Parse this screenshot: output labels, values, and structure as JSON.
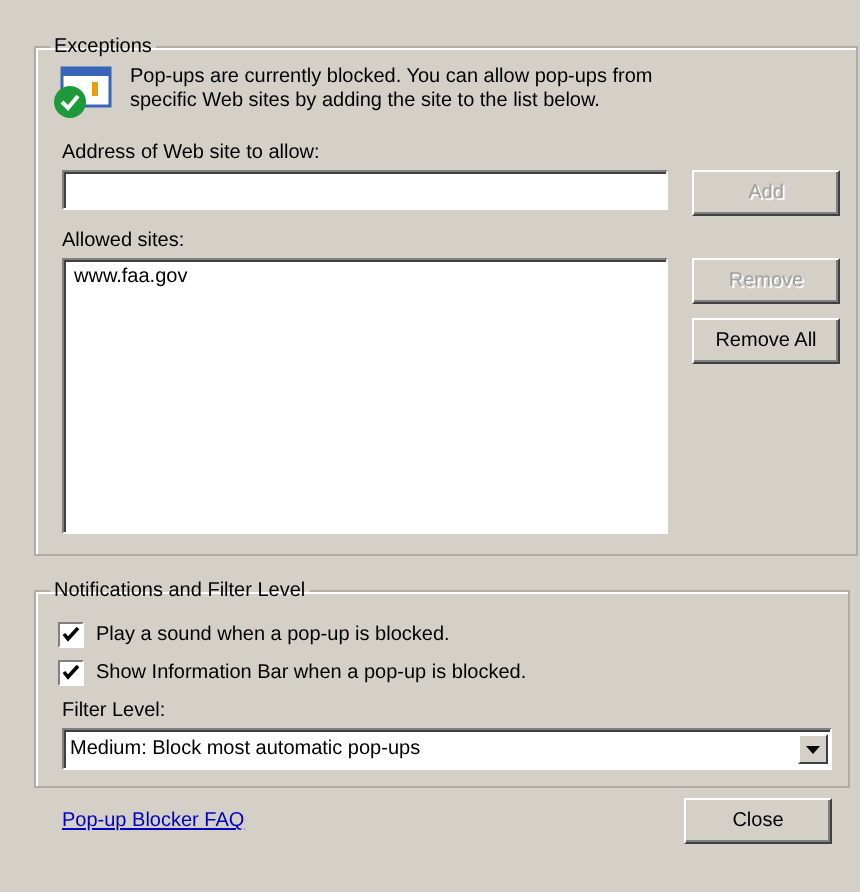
{
  "exceptions": {
    "title": "Exceptions",
    "description": "Pop-ups are currently blocked.  You can allow pop-ups from specific Web sites by adding the site to the list below.",
    "address_label": "Address of Web site to allow:",
    "add_button": {
      "label": "Add",
      "disabled": true
    },
    "allowed_label": "Allowed sites:",
    "allowed_sites": [
      {
        "label": "www.faa.gov",
        "selected": false
      }
    ],
    "buttons": [
      {
        "label": "Remove",
        "disabled": true
      },
      {
        "label": "Remove All",
        "disabled": false
      }
    ]
  },
  "notifications": {
    "title": "Notifications and Filter Level",
    "options": [
      {
        "label": "Play a sound when a pop-up is blocked.",
        "checked": true
      },
      {
        "label": "Show Information Bar when a pop-up is blocked.",
        "checked": true
      }
    ],
    "filter_label": "Filter Level:",
    "filter_value": "Medium: Block most automatic pop-ups"
  },
  "footer": {
    "link": "Pop-up Blocker FAQ",
    "close_button": "Close"
  }
}
